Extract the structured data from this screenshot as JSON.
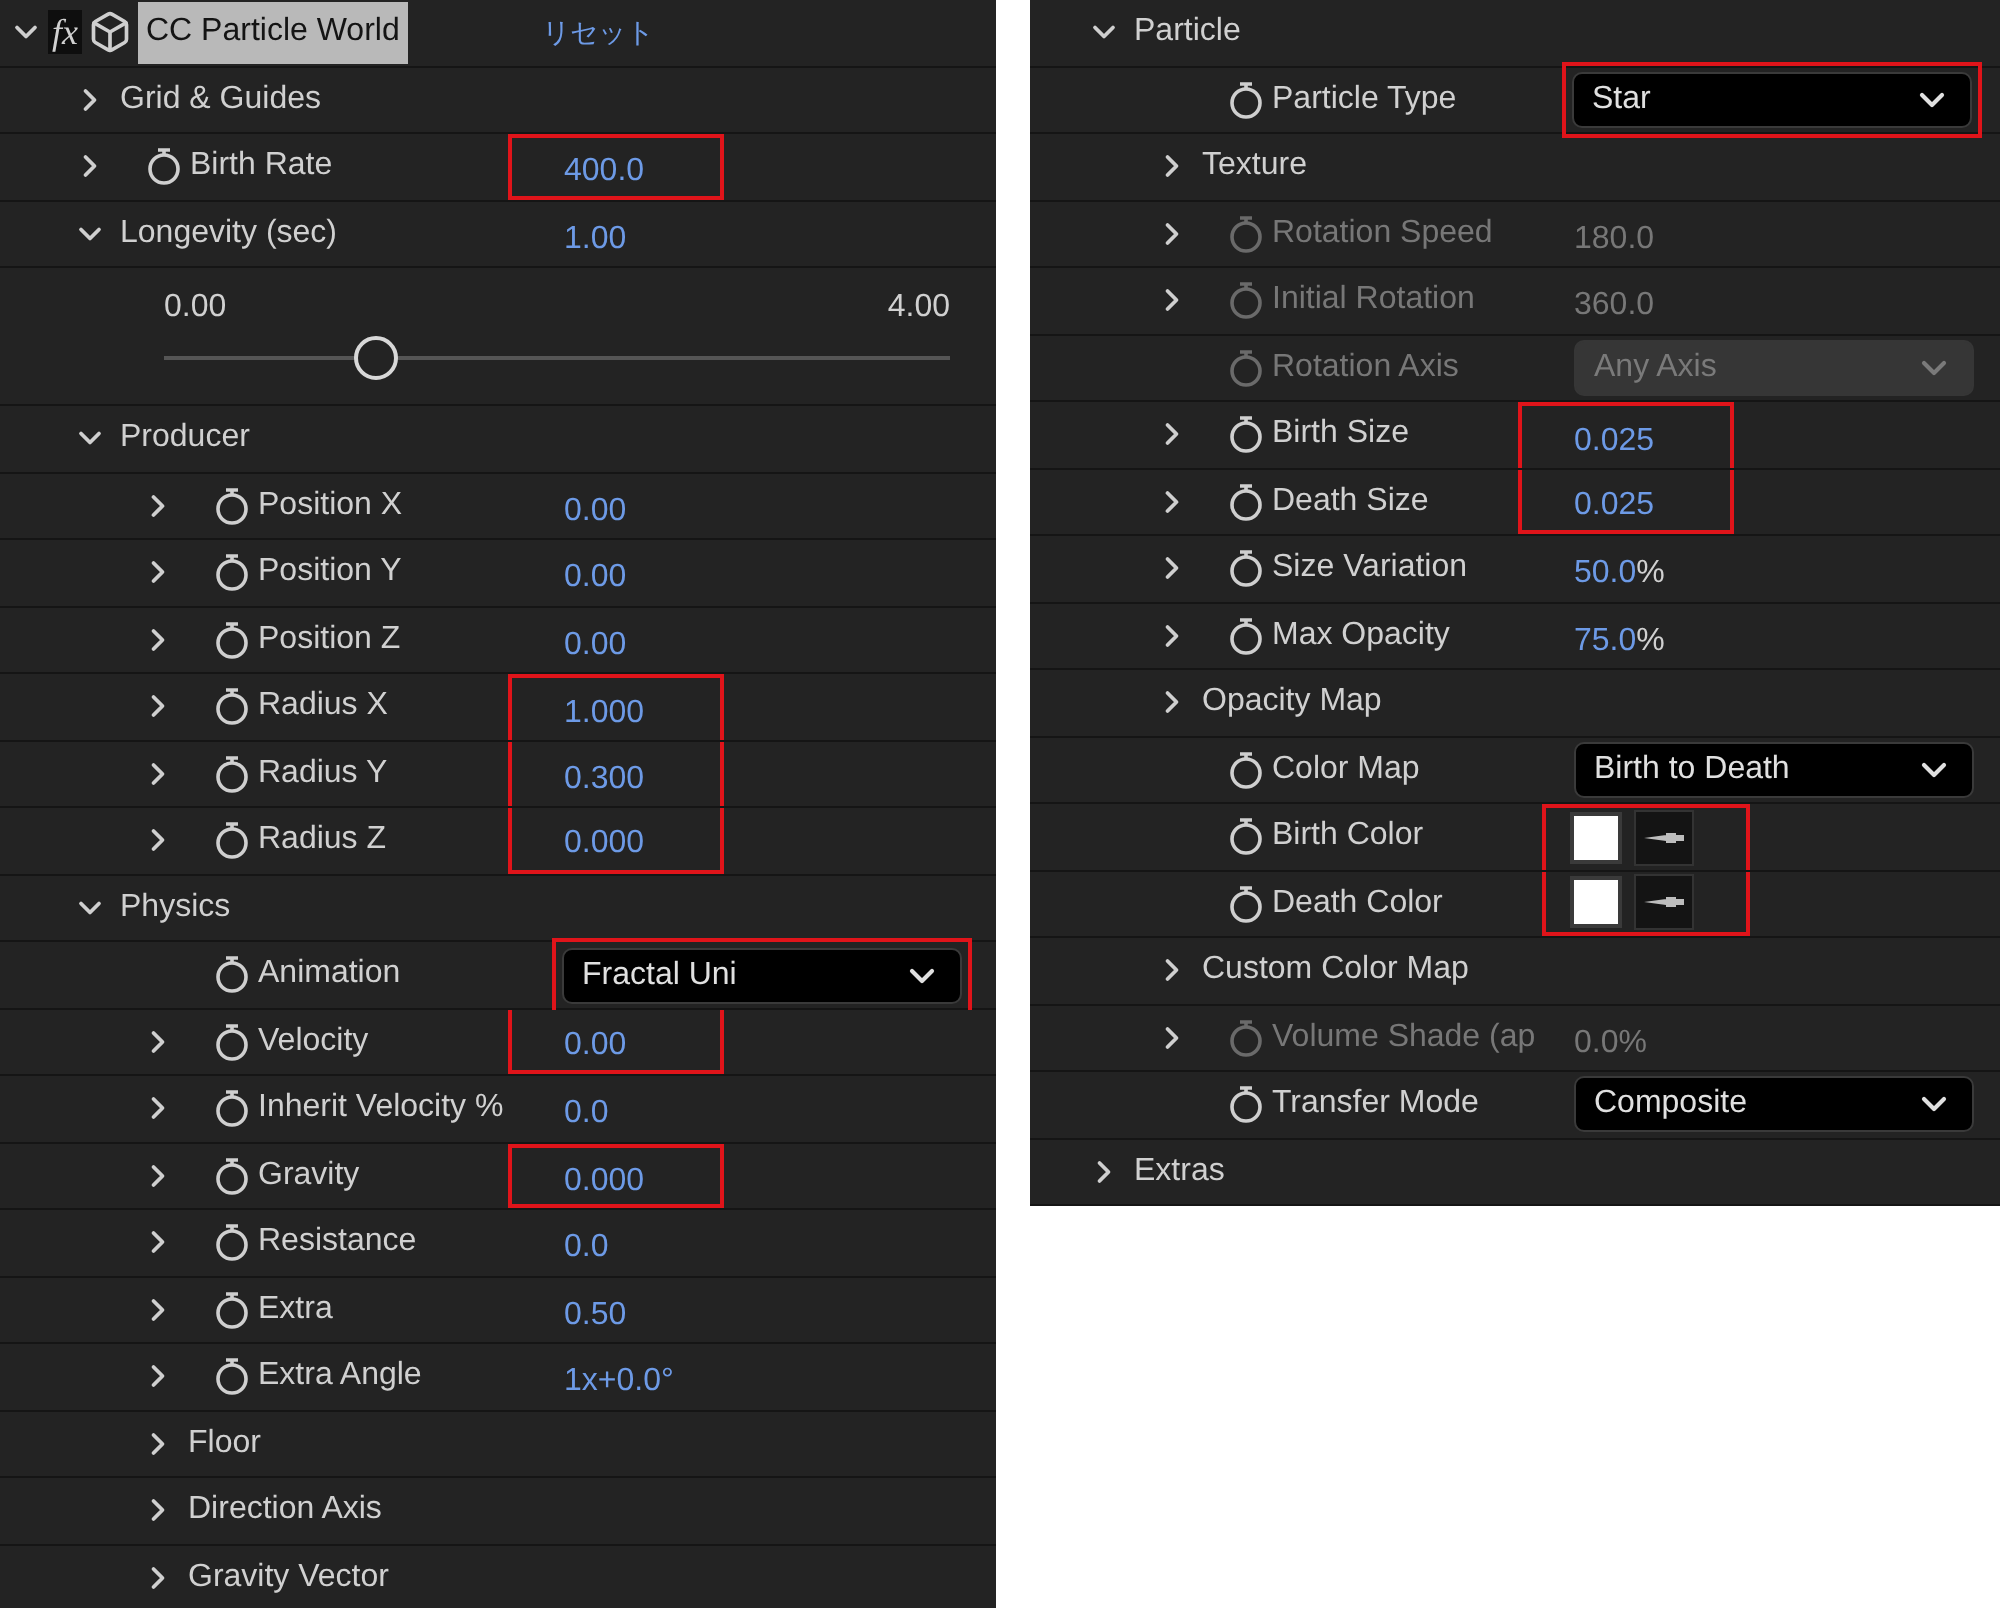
{
  "panels": [
    {
      "header": {
        "expanded": true,
        "badge": "fx",
        "title": "CC Particle World",
        "reset": "リセット"
      },
      "items": [
        {
          "label": "Grid & Guides",
          "expanded": false,
          "kind": "group"
        },
        {
          "label": "Birth Rate",
          "expanded": false,
          "stopwatch": true,
          "kind": "number",
          "value": "400.0",
          "highlighted": true
        },
        {
          "label": "Longevity (sec)",
          "expanded": true,
          "kind": "number",
          "value": "1.00",
          "slider": {
            "min": "0.00",
            "max": "4.00",
            "level": 0.27
          }
        },
        {
          "label": "Producer",
          "expanded": true,
          "kind": "group",
          "children": [
            {
              "label": "Position X",
              "expanded": false,
              "stopwatch": true,
              "kind": "number",
              "value": "0.00"
            },
            {
              "label": "Position Y",
              "expanded": false,
              "stopwatch": true,
              "kind": "number",
              "value": "0.00"
            },
            {
              "label": "Position Z",
              "expanded": false,
              "stopwatch": true,
              "kind": "number",
              "value": "0.00"
            },
            {
              "label": "Radius X",
              "expanded": false,
              "stopwatch": true,
              "kind": "number",
              "value": "1.000",
              "highlighted": true
            },
            {
              "label": "Radius Y",
              "expanded": false,
              "stopwatch": true,
              "kind": "number",
              "value": "0.300",
              "highlighted": true
            },
            {
              "label": "Radius Z",
              "expanded": false,
              "stopwatch": true,
              "kind": "number",
              "value": "0.000",
              "highlighted": true
            }
          ]
        },
        {
          "label": "Physics",
          "expanded": true,
          "kind": "group",
          "children": [
            {
              "label": "Animation",
              "stopwatch": true,
              "kind": "dropdown",
              "value": "Fractal Uni",
              "highlighted": true
            },
            {
              "label": "Velocity",
              "expanded": false,
              "stopwatch": true,
              "kind": "number",
              "value": "0.00",
              "highlighted": true
            },
            {
              "label": "Inherit Velocity %",
              "expanded": false,
              "stopwatch": true,
              "kind": "number",
              "value": "0.0"
            },
            {
              "label": "Gravity",
              "expanded": false,
              "stopwatch": true,
              "kind": "number",
              "value": "0.000",
              "highlighted": true
            },
            {
              "label": "Resistance",
              "expanded": false,
              "stopwatch": true,
              "kind": "number",
              "value": "0.0"
            },
            {
              "label": "Extra",
              "expanded": false,
              "stopwatch": true,
              "kind": "number",
              "value": "0.50"
            },
            {
              "label": "Extra Angle",
              "expanded": false,
              "stopwatch": true,
              "kind": "number",
              "value": "1x+0.0°"
            },
            {
              "label": "Floor",
              "expanded": false,
              "kind": "group"
            },
            {
              "label": "Direction Axis",
              "expanded": false,
              "kind": "group"
            },
            {
              "label": "Gravity Vector",
              "expanded": false,
              "kind": "group"
            }
          ]
        }
      ]
    },
    {
      "items": [
        {
          "label": "Particle",
          "expanded": true,
          "kind": "group",
          "children": [
            {
              "label": "Particle Type",
              "stopwatch": true,
              "kind": "dropdown",
              "value": "Star",
              "highlighted": true
            },
            {
              "label": "Texture",
              "expanded": false,
              "kind": "group"
            },
            {
              "label": "Rotation Speed",
              "expanded": false,
              "stopwatch": true,
              "kind": "number",
              "value": "180.0",
              "disabled": true
            },
            {
              "label": "Initial Rotation",
              "expanded": false,
              "stopwatch": true,
              "kind": "number",
              "value": "360.0",
              "disabled": true
            },
            {
              "label": "Rotation Axis",
              "stopwatch": true,
              "kind": "dropdown",
              "value": "Any Axis",
              "disabled": true
            },
            {
              "label": "Birth Size",
              "expanded": false,
              "stopwatch": true,
              "kind": "number",
              "value": "0.025",
              "highlighted": true
            },
            {
              "label": "Death Size",
              "expanded": false,
              "stopwatch": true,
              "kind": "number",
              "value": "0.025",
              "highlighted": true
            },
            {
              "label": "Size Variation",
              "expanded": false,
              "stopwatch": true,
              "kind": "number",
              "value": "50.0",
              "unit": "%"
            },
            {
              "label": "Max Opacity",
              "expanded": false,
              "stopwatch": true,
              "kind": "number",
              "value": "75.0",
              "unit": "%"
            },
            {
              "label": "Opacity Map",
              "expanded": false,
              "kind": "group"
            },
            {
              "label": "Color Map",
              "stopwatch": true,
              "kind": "dropdown",
              "value": "Birth to Death"
            },
            {
              "label": "Birth Color",
              "stopwatch": true,
              "kind": "color",
              "color": "#ffffff",
              "highlighted": true
            },
            {
              "label": "Death Color",
              "stopwatch": true,
              "kind": "color",
              "color": "#ffffff",
              "highlighted": true
            },
            {
              "label": "Custom Color Map",
              "expanded": false,
              "kind": "group"
            },
            {
              "label": "Volume Shade (ap",
              "expanded": false,
              "stopwatch": true,
              "kind": "number",
              "value": "0.0",
              "unit": "%",
              "disabled": true
            },
            {
              "label": "Transfer Mode",
              "stopwatch": true,
              "kind": "dropdown",
              "value": "Composite"
            }
          ]
        },
        {
          "label": "Extras",
          "expanded": false,
          "kind": "group"
        }
      ]
    }
  ]
}
